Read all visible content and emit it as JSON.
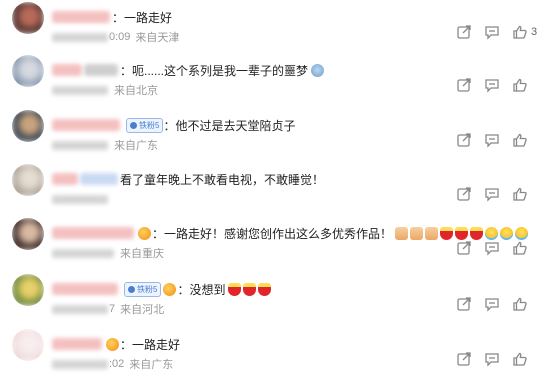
{
  "comments": [
    {
      "name_widths": [
        58
      ],
      "name_style": "pink",
      "badge": null,
      "medal": false,
      "text": "：一路走好",
      "emojis": [],
      "time_suffix": "0:09",
      "location": "来自天津",
      "like_count": "3",
      "avatar_colors": [
        "#4a2f2a",
        "#b86a5a",
        "#e8b9a8"
      ]
    },
    {
      "name_widths": [
        30,
        34
      ],
      "name_style": "pink",
      "badge": null,
      "medal": false,
      "text": "：呃......这个系列是我一辈子的噩梦",
      "emojis": [
        "shiver"
      ],
      "time_suffix": "",
      "location": "来自北京",
      "like_count": "",
      "avatar_colors": [
        "#8fa3b8",
        "#d7d9e0",
        "#6d6a80"
      ]
    },
    {
      "name_widths": [
        68
      ],
      "name_style": "pink",
      "badge": "铁粉5",
      "medal": false,
      "text": "：他不过是去天堂陪贞子",
      "emojis": [],
      "time_suffix": "",
      "location": "来自广东",
      "like_count": "",
      "avatar_colors": [
        "#2b3b4a",
        "#c9a37e",
        "#f4f4f4"
      ]
    },
    {
      "name_widths": [
        26,
        38
      ],
      "name_style": "mixed",
      "badge": null,
      "medal": false,
      "text": "看了童年晚上不敢看电视，不敢睡觉！",
      "emojis": [],
      "time_suffix": "",
      "location": "",
      "like_count": "",
      "avatar_colors": [
        "#b5aaa0",
        "#e5dcd2",
        "#9a8f85"
      ]
    },
    {
      "name_widths": [
        82
      ],
      "name_style": "pink",
      "badge": null,
      "medal": true,
      "text": "：一路走好！感谢您创作出这么多优秀作品！",
      "emojis": [
        "pray",
        "pray",
        "pray",
        "candle",
        "candle",
        "candle",
        "cry",
        "cry",
        "cry"
      ],
      "time_suffix": "",
      "location": "来自重庆",
      "like_count": "",
      "avatar_colors": [
        "#3a2a28",
        "#d9b9a3",
        "#7a4a3a"
      ]
    },
    {
      "name_widths": [
        66
      ],
      "name_style": "pink",
      "badge": "铁粉5",
      "medal": true,
      "text": "：没想到",
      "emojis": [
        "candle",
        "candle",
        "candle"
      ],
      "time_suffix": "7",
      "location": "来自河北",
      "like_count": "",
      "avatar_colors": [
        "#6f8a3a",
        "#e8d06a",
        "#b3b8a0"
      ]
    },
    {
      "name_widths": [
        50
      ],
      "name_style": "pink",
      "badge": null,
      "medal": true,
      "text": "：一路走好",
      "emojis": [],
      "time_suffix": ":02",
      "location": "来自广东",
      "like_count": "",
      "avatar_colors": [
        "#f2dede",
        "#f7eef0",
        "#e6c8d0"
      ]
    }
  ],
  "icons": {
    "share": "share-icon",
    "reply": "comment-icon",
    "like": "thumbs-up-icon"
  }
}
